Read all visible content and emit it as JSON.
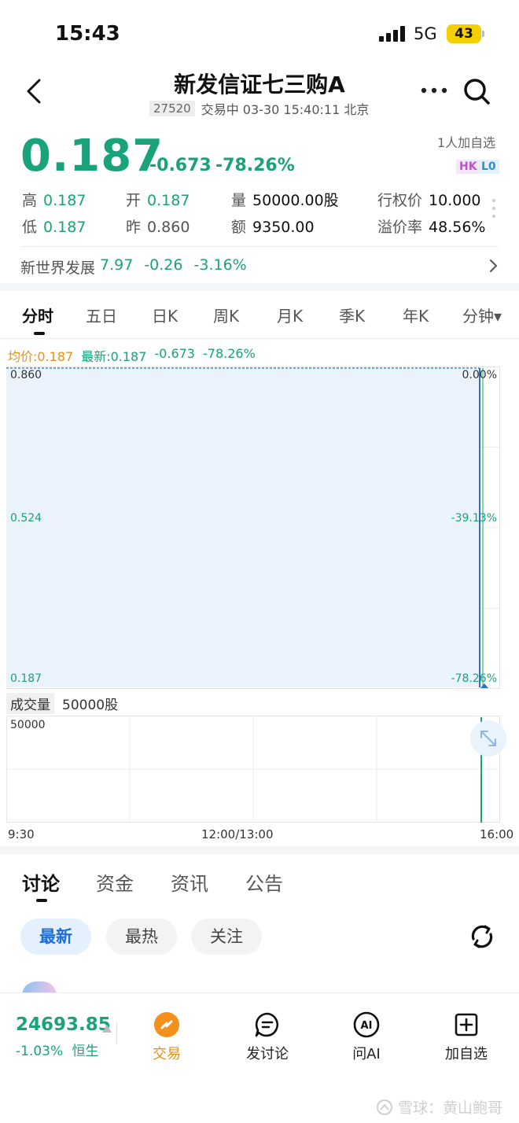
{
  "status_bar": {
    "time": "15:43",
    "network": "5G",
    "battery": "43"
  },
  "header": {
    "title": "新发信证七三购A",
    "code": "27520",
    "status_text": "交易中 03-30 15:40:11 北京"
  },
  "quote": {
    "price": "0.187",
    "change": "-0.673",
    "change_pct": "-78.26%",
    "followers": "1人加自选",
    "tag_hk": "HK",
    "tag_l0": "L0"
  },
  "stats": [
    {
      "key": "高",
      "value": "0.187",
      "color": "green"
    },
    {
      "key": "开",
      "value": "0.187",
      "color": "green"
    },
    {
      "key": "量",
      "value": "50000.00股",
      "color": "dark"
    },
    {
      "key": "行权价",
      "value": "10.000",
      "color": "dark"
    },
    {
      "key": "低",
      "value": "0.187",
      "color": "green"
    },
    {
      "key": "昨",
      "value": "0.860",
      "color": "gray"
    },
    {
      "key": "额",
      "value": "9350.00",
      "color": "dark"
    },
    {
      "key": "溢价率",
      "value": "48.56%",
      "color": "dark"
    }
  ],
  "related": {
    "name": "新世界发展",
    "price": "7.97",
    "change": "-0.26",
    "change_pct": "-3.16%"
  },
  "chart_tabs": [
    "分时",
    "五日",
    "日K",
    "周K",
    "月K",
    "季K",
    "年K",
    "分钟▾"
  ],
  "legend": {
    "avg": "均价:0.187",
    "latest": "最新:0.187",
    "change": "-0.673",
    "change_pct": "-78.26%"
  },
  "volume": {
    "title": "成交量",
    "value": "50000股",
    "axis_max": "50000"
  },
  "chart_data": {
    "type": "line",
    "y_labels_left": [
      "0.860",
      "0.524",
      "0.187"
    ],
    "y_labels_right": [
      "0.00%",
      "-39.13%",
      "-78.26%"
    ],
    "ylim": [
      0.187,
      0.86
    ],
    "x_labels": [
      "9:30",
      "12:00/13:00",
      "16:00"
    ],
    "series": [
      {
        "values": [
          0.86,
          0.187
        ]
      }
    ],
    "volume_values": [
      50000
    ],
    "grid": true
  },
  "discussion_tabs": [
    "讨论",
    "资金",
    "资讯",
    "公告"
  ],
  "filters": [
    "最新",
    "最热",
    "关注"
  ],
  "bottom_bar": {
    "index_value": "24693.85",
    "index_change": "-1.03%",
    "index_name": "恒生",
    "nav": [
      {
        "label": "交易",
        "icon": "trade-icon"
      },
      {
        "label": "发讨论",
        "icon": "post-discussion-icon"
      },
      {
        "label": "问AI",
        "icon": "ai-icon"
      },
      {
        "label": "加自选",
        "icon": "add-watchlist-icon"
      }
    ]
  },
  "watermark": "雪球：黄山鲍哥",
  "colors": {
    "down": "#1aa37a",
    "accent_orange": "#e8901c",
    "chart_fill": "#eaf2fb",
    "chart_line": "#2b73c8"
  }
}
